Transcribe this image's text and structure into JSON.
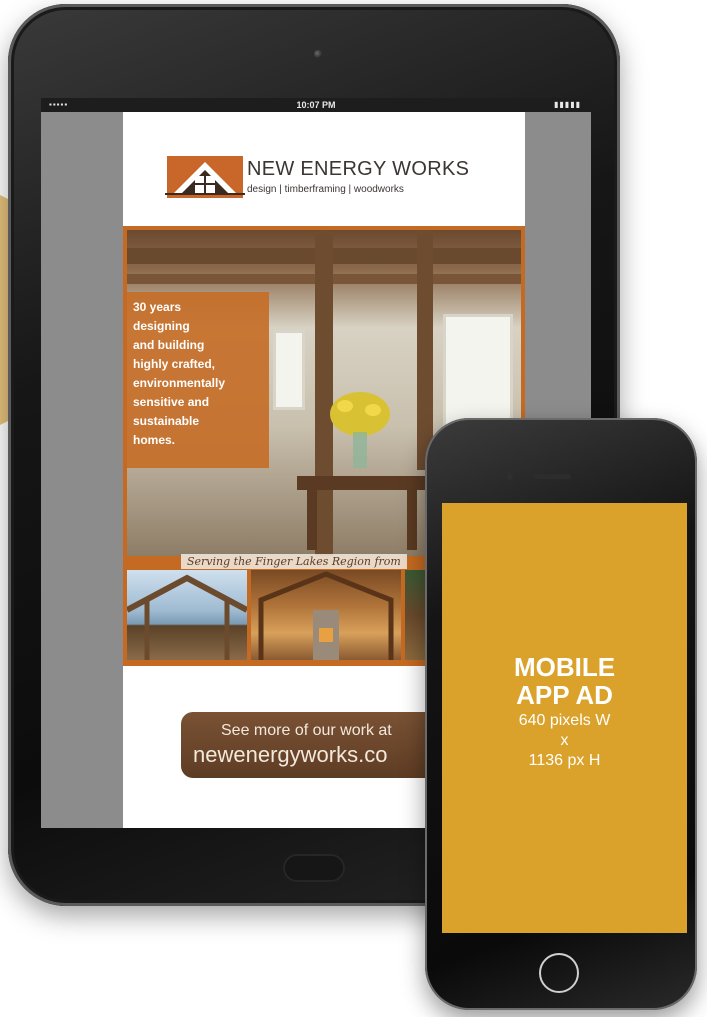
{
  "tablet": {
    "status_time": "10:07 PM",
    "ad": {
      "brand_name": "NEW ENERGY WORKS",
      "brand_tagline": "design | timberframing | woodworks",
      "overlay_lines": [
        "30 years",
        "designing",
        "and building",
        "highly crafted,",
        "environmentally",
        "sensitive and",
        "sustainable",
        "homes."
      ],
      "strip_text": "Serving the Finger Lakes Region from",
      "cta_line1": "See more of our work at",
      "cta_line2": "newenergyworks.co"
    }
  },
  "phone": {
    "title_line1": "MOBILE",
    "title_line2": "APP AD",
    "spec_line1": "640 pixels W",
    "spec_line2": "x",
    "spec_line3": "1136 px H"
  },
  "colors": {
    "accent_orange": "#c56a22",
    "phone_ad_gold": "#dba22b",
    "starburst": "#e7c27d"
  }
}
